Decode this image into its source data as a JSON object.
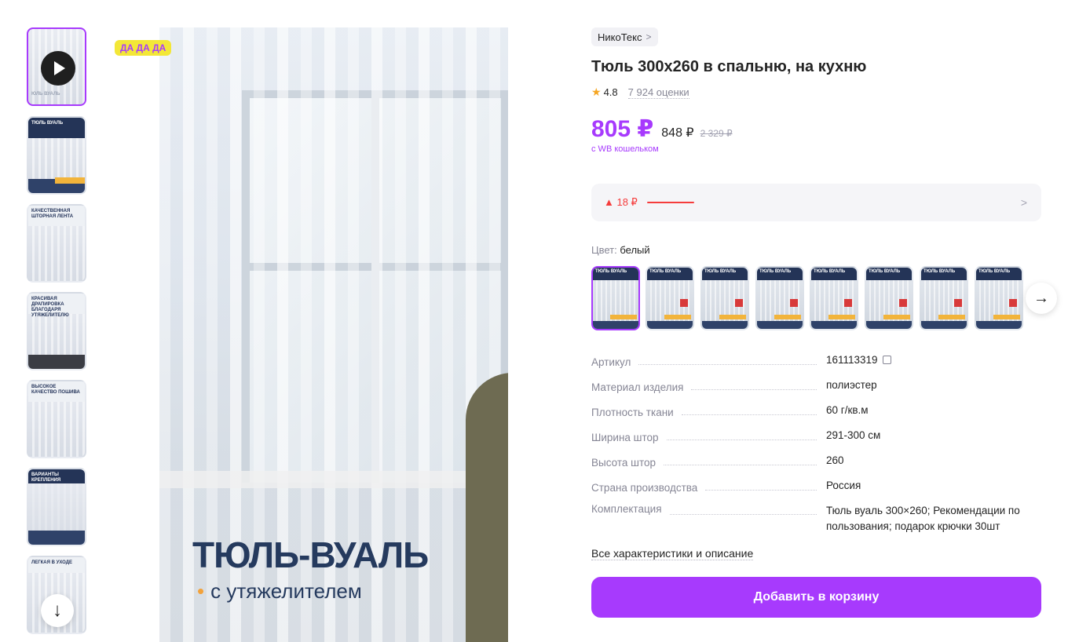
{
  "gallery": {
    "badge": "ДА ДА ДА",
    "main_title": "ТЮЛЬ-ВУАЛЬ",
    "main_subtitle": "с утяжелителем",
    "thumbs": [
      {
        "label": "ЮЛЬ ВУАЛЬ"
      },
      {
        "label": "ТЮЛЬ ВУАЛЬ"
      },
      {
        "label": "КАЧЕСТВЕННАЯ ШТОРНАЯ ЛЕНТА"
      },
      {
        "label": "КРАСИВАЯ ДРАПИРОВКА БЛАГОДАРЯ УТЯЖЕЛИТЕЛЮ"
      },
      {
        "label": "ВЫСОКОЕ КАЧЕСТВО ПОШИВА"
      },
      {
        "label": "ВАРИАНТЫ КРЕПЛЕНИЯ"
      },
      {
        "label": "ЛЕГКАЯ В УХОДЕ"
      }
    ]
  },
  "product": {
    "brand": "НикоТекс",
    "title": "Тюль 300х260 в спальню, на кухню",
    "rating": "4.8",
    "reviews": "7 924 оценки",
    "price": "805 ₽",
    "price_secondary": "848 ₽",
    "price_old": "2 329 ₽",
    "wallet_note": "с WB кошельком",
    "price_delta": "▲ 18 ₽",
    "color_label": "Цвет:",
    "color_value": "белый",
    "swatch_label": "ТЮЛЬ ВУАЛЬ",
    "specs": [
      {
        "key": "Артикул",
        "value": "161113319"
      },
      {
        "key": "Материал изделия",
        "value": "полиэстер"
      },
      {
        "key": "Плотность ткани",
        "value": "60 г/кв.м"
      },
      {
        "key": "Ширина штор",
        "value": "291-300 см"
      },
      {
        "key": "Высота штор",
        "value": "260"
      },
      {
        "key": "Страна производства",
        "value": "Россия"
      },
      {
        "key": "Комплектация",
        "value": "Тюль вуаль 300×260; Рекомендации по пользования; подарок крючки 30шт"
      }
    ],
    "all_specs_link": "Все характеристики и описание",
    "add_to_cart": "Добавить в корзину"
  },
  "colors": {
    "accent": "#a73afd",
    "price_up": "#f53c3c",
    "star": "#f6a623"
  }
}
